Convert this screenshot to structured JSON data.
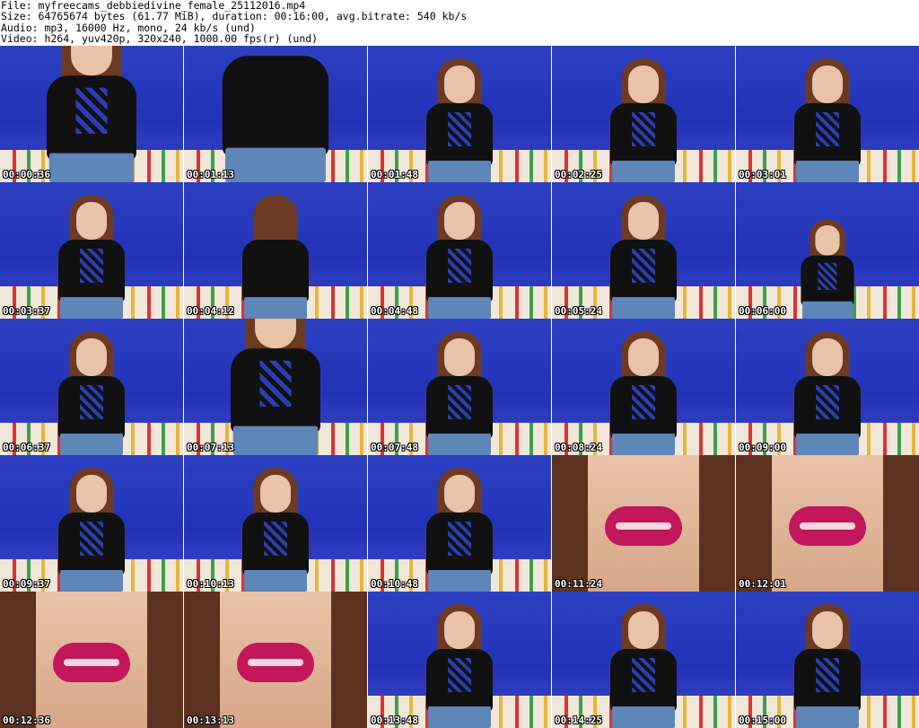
{
  "header": {
    "line1": "File: myfreecams_debbiedivine_female_25112016.mp4",
    "line2": "Size: 64765674 bytes (61.77 MiB), duration: 00:16:00, avg.bitrate: 540 kb/s",
    "line3": "Audio: mp3, 16000 Hz, mono, 24 kb/s (und)",
    "line4": "Video: h264, yuv420p, 320x240, 1000.00 fps(r) (und)"
  },
  "thumbnails": [
    {
      "time": "00:00:36",
      "scene": "torso"
    },
    {
      "time": "00:01:13",
      "scene": "shorts"
    },
    {
      "time": "00:01:48",
      "scene": "full"
    },
    {
      "time": "00:02:25",
      "scene": "full"
    },
    {
      "time": "00:03:01",
      "scene": "full"
    },
    {
      "time": "00:03:37",
      "scene": "full"
    },
    {
      "time": "00:04:12",
      "scene": "back"
    },
    {
      "time": "00:04:48",
      "scene": "full"
    },
    {
      "time": "00:05:24",
      "scene": "full"
    },
    {
      "time": "00:06:00",
      "scene": "far"
    },
    {
      "time": "00:06:37",
      "scene": "full"
    },
    {
      "time": "00:07:13",
      "scene": "torso"
    },
    {
      "time": "00:07:48",
      "scene": "full"
    },
    {
      "time": "00:08:24",
      "scene": "full"
    },
    {
      "time": "00:09:00",
      "scene": "full"
    },
    {
      "time": "00:09:37",
      "scene": "full"
    },
    {
      "time": "00:10:13",
      "scene": "full"
    },
    {
      "time": "00:10:48",
      "scene": "full"
    },
    {
      "time": "00:11:24",
      "scene": "lips"
    },
    {
      "time": "00:12:01",
      "scene": "lips"
    },
    {
      "time": "00:12:36",
      "scene": "lips"
    },
    {
      "time": "00:13:13",
      "scene": "lips"
    },
    {
      "time": "00:13:48",
      "scene": "full"
    },
    {
      "time": "00:14:25",
      "scene": "full"
    },
    {
      "time": "00:15:00",
      "scene": "full"
    }
  ]
}
